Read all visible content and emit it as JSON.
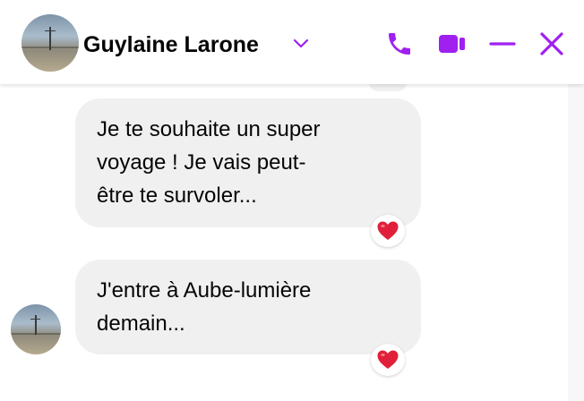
{
  "header": {
    "contact_name": "Guylaine Larone",
    "icons": {
      "avatar": "contact-avatar",
      "chevron": "chevron-down-icon",
      "call": "phone-icon",
      "video": "video-camera-icon",
      "minimize": "minimize-icon",
      "close": "close-icon"
    },
    "accent_color": "#a020f0"
  },
  "messages": [
    {
      "text": "Je te souhaite un super\nvoyage !  Je vais peut-\nêtre te survoler...",
      "reaction": "red-heart",
      "reaction_glyph": "❤️"
    },
    {
      "text": "J'entre à Aube-lumière\ndemain...",
      "reaction": "red-heart",
      "reaction_glyph": "❤️"
    }
  ],
  "colors": {
    "bubble_bg": "#f0f0f0",
    "text": "#050505",
    "heart": "#e0203a"
  }
}
